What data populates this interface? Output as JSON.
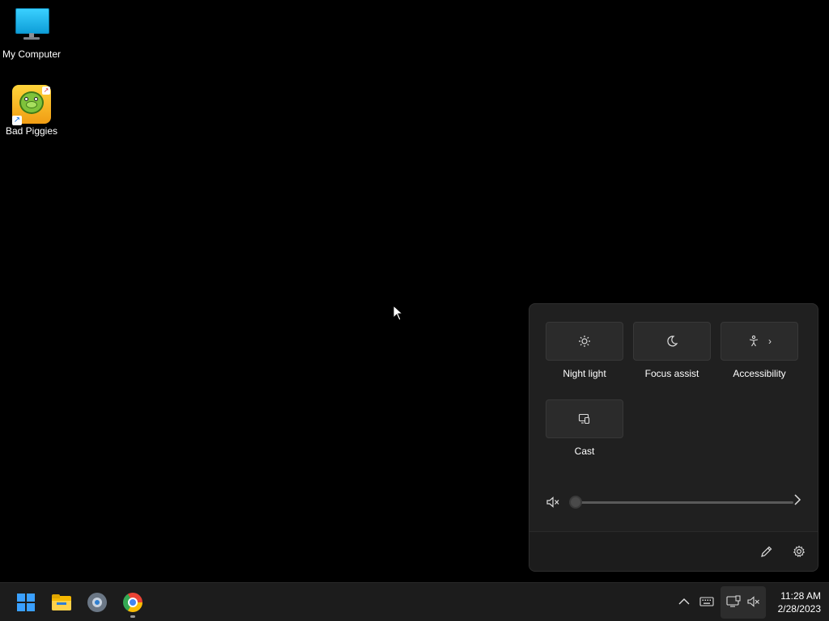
{
  "desktop": {
    "icons": [
      {
        "label": "My Computer",
        "icon": "monitor-icon"
      },
      {
        "label": "Bad Piggies",
        "icon": "bad-piggies-icon"
      }
    ]
  },
  "quick_settings": {
    "tiles": [
      {
        "label": "Night light",
        "icon": "night-light-icon"
      },
      {
        "label": "Focus assist",
        "icon": "moon-icon"
      },
      {
        "label": "Accessibility",
        "icon": "accessibility-icon"
      },
      {
        "label": "Cast",
        "icon": "cast-icon"
      }
    ],
    "volume": {
      "level": 0,
      "muted": true,
      "icon": "speaker-muted-icon"
    },
    "footer": {
      "edit_icon": "pencil-icon",
      "settings_icon": "gear-icon"
    }
  },
  "taskbar": {
    "apps": [
      {
        "name": "Start",
        "icon": "windows-logo-icon"
      },
      {
        "name": "File Explorer",
        "icon": "folder-icon"
      },
      {
        "name": "Settings",
        "icon": "settings-gear-icon"
      },
      {
        "name": "Google Chrome",
        "icon": "chrome-icon"
      }
    ],
    "tray": {
      "icons": [
        "chevron-up-icon",
        "keyboard-icon",
        "network-icon",
        "speaker-muted-icon"
      ]
    },
    "clock": {
      "time": "11:28 AM",
      "date": "2/28/2023"
    }
  },
  "colors": {
    "desktop_bg": "#000000",
    "flyout_bg": "#202020",
    "tile_bg": "#2b2b2b",
    "taskbar_bg": "#1c1c1c",
    "accent": "#3aa0ff"
  }
}
